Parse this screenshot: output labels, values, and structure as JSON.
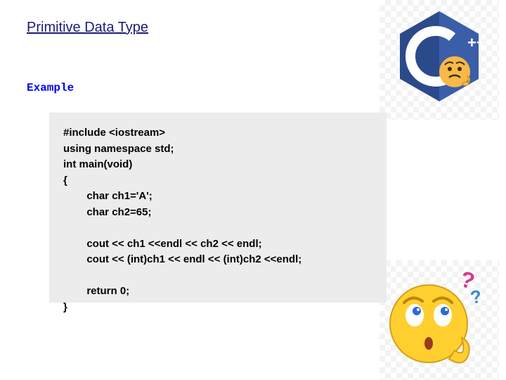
{
  "title": "Primitive Data Type",
  "example_label": "Example",
  "code": "#include <iostream>\nusing namespace std;\nint main(void)\n{\n        char ch1='A';\n        char ch2=65;\n\n        cout << ch1 <<endl << ch2 << endl;\n        cout << (int)ch1 << endl << (int)ch2 <<endl;\n\n        return 0;\n}",
  "logo_text": "++",
  "icons": {
    "cpp_logo": "cpp-logo-icon",
    "thinking_emoji": "thinking-emoji-icon",
    "question_marks": "question-mark-icon"
  }
}
